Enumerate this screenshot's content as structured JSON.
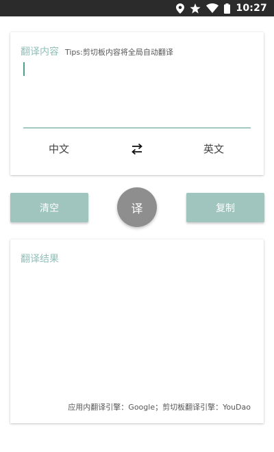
{
  "status_bar": {
    "time": "10:27",
    "icons": [
      "location-icon",
      "star-icon",
      "wifi-icon",
      "battery-icon"
    ]
  },
  "input_card": {
    "title": "翻译内容",
    "tips": "Tips:剪切板内容将全局自动翻译",
    "input_value": "",
    "source_lang": "中文",
    "target_lang": "英文",
    "swap_icon": "swap-arrows-icon"
  },
  "actions": {
    "clear_label": "清空",
    "translate_label": "译",
    "copy_label": "复制"
  },
  "result_card": {
    "title": "翻译结果",
    "result_text": "",
    "engine_note": "应用内翻译引擎：Google；剪切板翻译引擎：YouDao"
  },
  "colors": {
    "status_bar": "#2b2b2b",
    "accent_text": "#8fbfb6",
    "button": "#a0c5be",
    "fab": "#8e8e8e",
    "cursor": "#4a9e8e"
  }
}
